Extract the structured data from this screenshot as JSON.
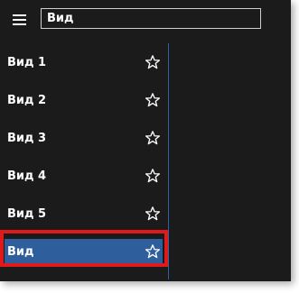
{
  "search": {
    "value": "Вид"
  },
  "sidebar": {
    "items": [
      {
        "label": "Вид 1",
        "icon": "star-outline-icon"
      },
      {
        "label": "Вид 2",
        "icon": "star-outline-icon"
      },
      {
        "label": "Вид 3",
        "icon": "star-outline-icon"
      },
      {
        "label": "Вид 4",
        "icon": "star-outline-icon"
      },
      {
        "label": "Вид 5",
        "icon": "star-outline-icon"
      },
      {
        "label": "Вид",
        "icon": "star-outline-icon",
        "selected": true
      }
    ]
  },
  "colors": {
    "background": "#1b1b1b",
    "accent": "#2f5e9c",
    "divider": "#2b5fa6",
    "highlight": "#e01a1a",
    "text": "#ffffff"
  }
}
